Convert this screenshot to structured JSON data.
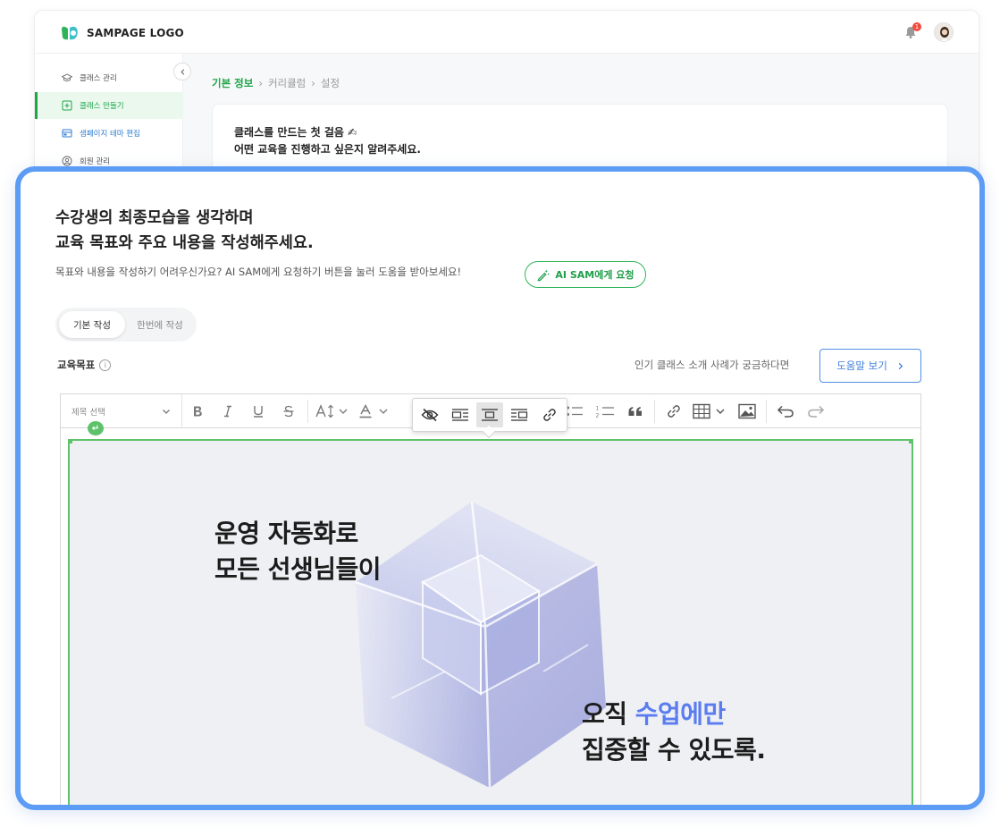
{
  "app": {
    "logo_text": "SAMPAGE LOGO",
    "notification_count": "1"
  },
  "sidebar": {
    "items": [
      {
        "label": "클래스 관리",
        "icon": "graduation-cap-icon"
      },
      {
        "label": "클래스 만들기",
        "icon": "add-square-icon"
      },
      {
        "label": "샘페이지 테마 편집",
        "icon": "layout-icon"
      },
      {
        "label": "회원 관리",
        "icon": "user-circle-icon"
      }
    ]
  },
  "breadcrumb": {
    "steps": [
      "기본 정보",
      "커리큘럼",
      "설정"
    ]
  },
  "intro_card": {
    "line1": "클래스를 만드는 첫 걸음 ✍",
    "line2": "어떤 교육을 진행하고 싶은지 알려주세요."
  },
  "panel": {
    "heading_line1": "수강생의 최종모습을 생각하며",
    "heading_line2": "교육 목표와 주요 내용을 작성해주세요.",
    "subtext": "목표와 내용을 작성하기 어려우신가요? AI SAM에게 요청하기 버튼을 눌러 도움을 받아보세요!",
    "ai_button_label": "AI SAM에게 요청",
    "tabs": [
      "기본 작성",
      "한번에 작성"
    ],
    "field_label": "교육목표",
    "help_text": "인기 클래스 소개 사례가 궁금하다면",
    "help_button_label": "도움말 보기"
  },
  "editor": {
    "heading_select_placeholder": "제목 선택",
    "banner_line1": "운영 자동화로",
    "banner_line2": "모든 선생님들이",
    "banner_line3_a": "오직 ",
    "banner_line3_b": "수업에만",
    "banner_line4": "집중할 수 있도록."
  },
  "colors": {
    "brand_green": "#1fa64a",
    "highlight_blue": "#5c9cf5",
    "accent_blue": "#5b7cf0",
    "image_selection": "#5ec26a"
  }
}
